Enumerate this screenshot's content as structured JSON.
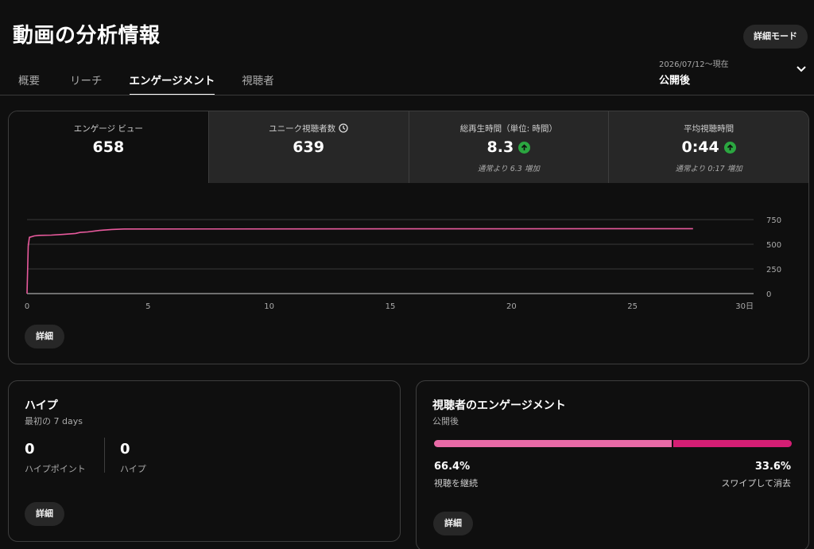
{
  "page": {
    "title": "動画の分析情報",
    "detail_mode_label": "詳細モード"
  },
  "tabs": [
    {
      "label": "概要",
      "active": false
    },
    {
      "label": "リーチ",
      "active": false
    },
    {
      "label": "エンゲージメント",
      "active": true
    },
    {
      "label": "視聴者",
      "active": false
    }
  ],
  "date_range": {
    "range": "2026/07/12～現在",
    "label": "公開後"
  },
  "metrics": [
    {
      "label": "エンゲージ ビュー",
      "value": "658",
      "note": ""
    },
    {
      "label": "ユニーク視聴者数",
      "value": "639",
      "note": ""
    },
    {
      "label": "総再生時間（単位: 時間）",
      "value": "8.3",
      "note": "通常より 6.3 増加"
    },
    {
      "label": "平均視聴時間",
      "value": "0:44",
      "note": "通常より 0:17 増加"
    }
  ],
  "chart_data": {
    "type": "line",
    "series": [
      {
        "x": [
          0,
          0.05,
          0.1,
          0.3,
          0.5,
          1,
          1.5,
          2,
          2.2,
          2.5,
          3,
          3.5,
          4,
          27.5
        ],
        "y": [
          0,
          480,
          570,
          585,
          590,
          593,
          600,
          610,
          620,
          625,
          640,
          650,
          655,
          658
        ]
      }
    ],
    "x_ticks": [
      "0",
      "5",
      "10",
      "15",
      "20",
      "25",
      "30日"
    ],
    "x_tick_values": [
      0,
      5,
      10,
      15,
      20,
      25,
      30
    ],
    "y_ticks": [
      "0",
      "250",
      "500",
      "750"
    ],
    "y_tick_values": [
      0,
      250,
      500,
      750
    ],
    "xlim": [
      0,
      30
    ],
    "ylim": [
      0,
      750
    ],
    "grid": true,
    "color": "#e85a9d"
  },
  "main_detail_label": "詳細",
  "hype": {
    "title": "ハイプ",
    "subtitle": "最初の 7 days",
    "points_value": "0",
    "points_label": "ハイプポイント",
    "hype_value": "0",
    "hype_label": "ハイプ",
    "detail_label": "詳細"
  },
  "audience_engagement": {
    "title": "視聴者のエンゲージメント",
    "subtitle": "公開後",
    "continued_pct": "66.4%",
    "continued_label": "視聴を継続",
    "continued_fraction": 0.664,
    "swiped_pct": "33.6%",
    "swiped_label": "スワイプして消去",
    "detail_label": "詳細"
  },
  "colors": {
    "accent_pink": "#e86aa6",
    "accent_magenta": "#d41e74",
    "up_green": "#2ba640"
  },
  "icons": {
    "up": "arrow-up-icon",
    "clock": "clock-icon",
    "chevron": "chevron-down-icon"
  }
}
